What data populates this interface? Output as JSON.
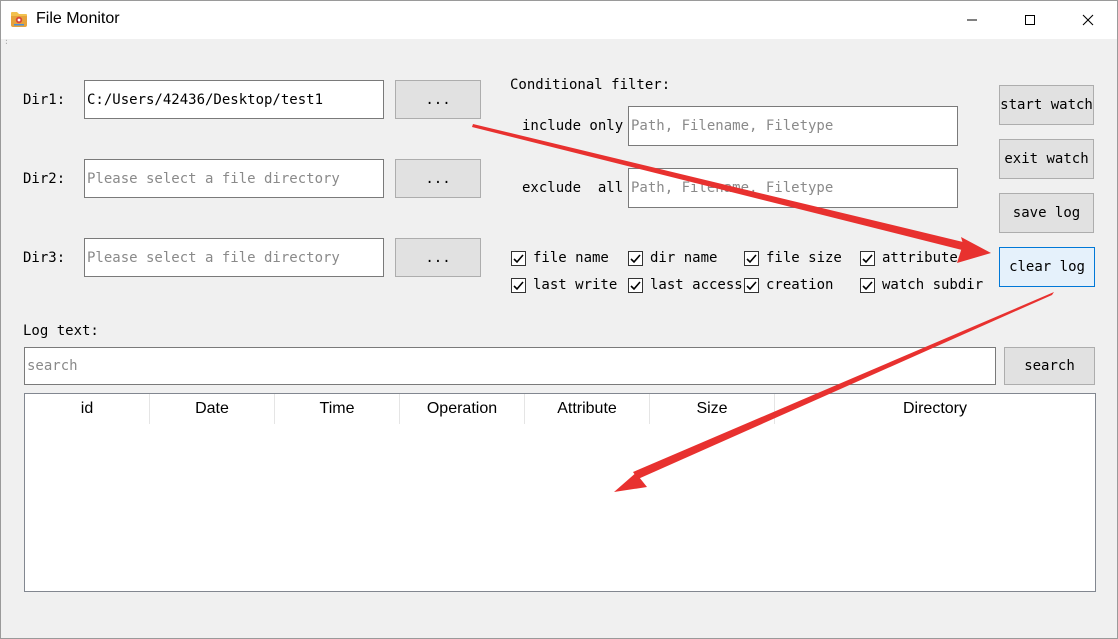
{
  "window": {
    "title": "File Monitor",
    "icon": "app-folder-icon",
    "controls": {
      "minimize": "minimize-icon",
      "maximize": "maximize-icon",
      "close": "close-icon"
    }
  },
  "dirs": [
    {
      "label": "Dir1:",
      "value": "C:/Users/42436/Desktop/test1",
      "placeholder": "",
      "browse_label": "..."
    },
    {
      "label": "Dir2:",
      "value": "",
      "placeholder": "Please select a file directory",
      "browse_label": "..."
    },
    {
      "label": "Dir3:",
      "value": "",
      "placeholder": "Please select a file directory",
      "browse_label": "..."
    }
  ],
  "filter": {
    "title": "Conditional filter:",
    "include_label": "include only",
    "include_placeholder": "Path, Filename, Filetype",
    "exclude_label": "exclude  all",
    "exclude_placeholder": "Path, Filename, Filetype"
  },
  "checkboxes": [
    {
      "label": "file name",
      "checked": true
    },
    {
      "label": "dir name",
      "checked": true
    },
    {
      "label": "file size",
      "checked": true
    },
    {
      "label": "attribute",
      "checked": true
    },
    {
      "label": "last write",
      "checked": true
    },
    {
      "label": "last access",
      "checked": true
    },
    {
      "label": "creation",
      "checked": true
    },
    {
      "label": "watch subdir",
      "checked": true
    }
  ],
  "actions": {
    "start_watch": "start watch",
    "exit_watch": "exit watch",
    "save_log": "save log",
    "clear_log": "clear log"
  },
  "log": {
    "title": "Log text:",
    "search_placeholder": "search",
    "search_button": "search",
    "columns": [
      "id",
      "Date",
      "Time",
      "Operation",
      "Attribute",
      "Size",
      "Directory"
    ]
  },
  "colors": {
    "annotation_arrow": "#e8312f",
    "focus_border": "#0078d7",
    "focus_fill": "#e5f1fb"
  }
}
